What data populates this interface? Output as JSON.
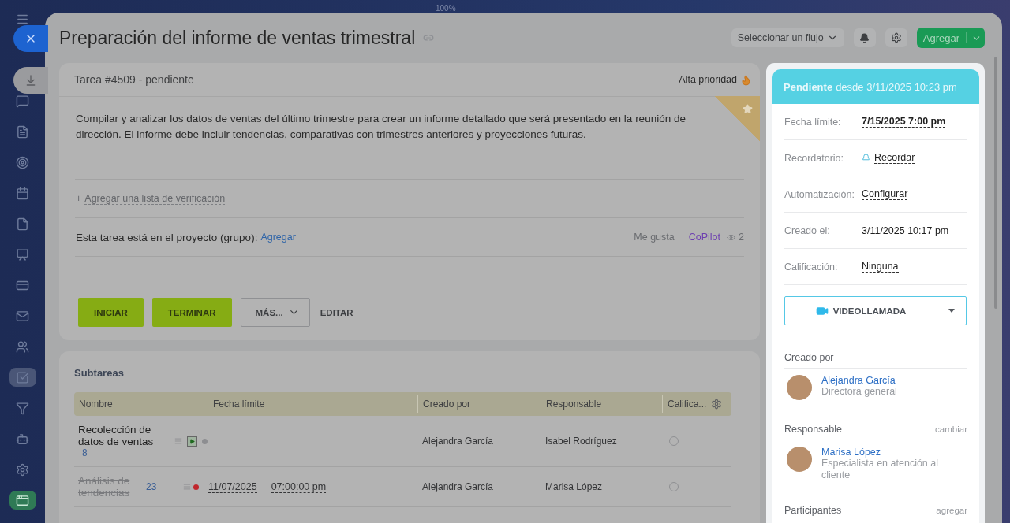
{
  "top_bar": {
    "zoom": "100%"
  },
  "sidebar": {
    "items": [
      {
        "kind": "menu",
        "selected": false
      },
      {
        "kind": "chat",
        "selected": false
      },
      {
        "kind": "document",
        "selected": false
      },
      {
        "kind": "target",
        "selected": false
      },
      {
        "kind": "calendar",
        "selected": false
      },
      {
        "kind": "file",
        "selected": false
      },
      {
        "kind": "presentation",
        "selected": false
      },
      {
        "kind": "card",
        "selected": false
      },
      {
        "kind": "mail",
        "selected": false
      },
      {
        "kind": "contacts",
        "selected": false
      },
      {
        "kind": "tasks",
        "selected": true
      },
      {
        "kind": "filter",
        "selected": false
      },
      {
        "kind": "robot",
        "selected": false
      },
      {
        "kind": "settings",
        "selected": false
      },
      {
        "kind": "app",
        "selected": false
      }
    ]
  },
  "title": "Preparación del informe de ventas trimestral",
  "header_actions": {
    "flow_select": "Seleccionar un flujo",
    "add_button": "Agregar"
  },
  "task": {
    "heading": "Tarea #4509 - pendiente",
    "priority": "Alta prioridad",
    "high_priority": true,
    "favorite": true,
    "description": "Compilar y analizar los datos de ventas del último trimestre para crear un informe detallado que será presentado en la reunión de dirección. El informe debe incluir tendencias, comparativas con trimestres anteriores y proyecciones futuras.",
    "checklist_plus": "+",
    "checklist_link": "Agregar una lista de verificación",
    "project_label": "Esta tarea está en el proyecto (grupo):",
    "project_link": "Agregar",
    "like": "Me gusta",
    "copilot": "CoPilot",
    "views": "2"
  },
  "actions": [
    {
      "label": "INICIAR",
      "kind": "primary"
    },
    {
      "label": "TERMINAR",
      "kind": "primary"
    },
    {
      "label": "MÁS...",
      "kind": "menu"
    },
    {
      "label": "EDITAR",
      "kind": "link"
    }
  ],
  "subtasks": {
    "title": "Subtareas",
    "columns": [
      "Nombre",
      "Fecha límite",
      "Creado por",
      "Responsable",
      "Califica..."
    ],
    "rows": [
      {
        "name": "Recolección de datos de ventas",
        "count": "8",
        "completed": false,
        "play_control": true,
        "overdue": false,
        "rated": false,
        "creator": "Alejandra García",
        "responsible": "Isabel Rodríguez"
      },
      {
        "name": "Análisis de tendencias",
        "count": "23",
        "completed": true,
        "play_control": false,
        "overdue": true,
        "rated": false,
        "deadline_date": "11/07/2025",
        "deadline_time": "07:00:00 pm",
        "creator": "Alejandra García",
        "responsible": "Marisa López"
      }
    ]
  },
  "status": {
    "state": "Pendiente",
    "since": "desde 3/11/2025 10:23 pm"
  },
  "fields": [
    {
      "label": "Fecha límite:",
      "value": "7/15/2025 7:00 pm",
      "kind": "bold"
    },
    {
      "label": "Recordatorio:",
      "value": "Recordar",
      "kind": "reminder"
    },
    {
      "label": "Automatización:",
      "value": "Configurar",
      "kind": "link"
    },
    {
      "label": "Creado el:",
      "value": "3/11/2025 10:17 pm",
      "kind": "plain"
    },
    {
      "label": "Calificación:",
      "value": "Ninguna",
      "kind": "link"
    }
  ],
  "video_call": "VIDEOLLAMADA",
  "people": [
    {
      "heading": "Creado por",
      "name": "Alejandra García",
      "role": "Directora general"
    },
    {
      "heading": "Responsable",
      "action": "cambiar",
      "name": "Marisa López",
      "role": "Especialista en atención al cliente"
    }
  ],
  "participants": {
    "heading": "Participantes",
    "action": "agregar"
  }
}
